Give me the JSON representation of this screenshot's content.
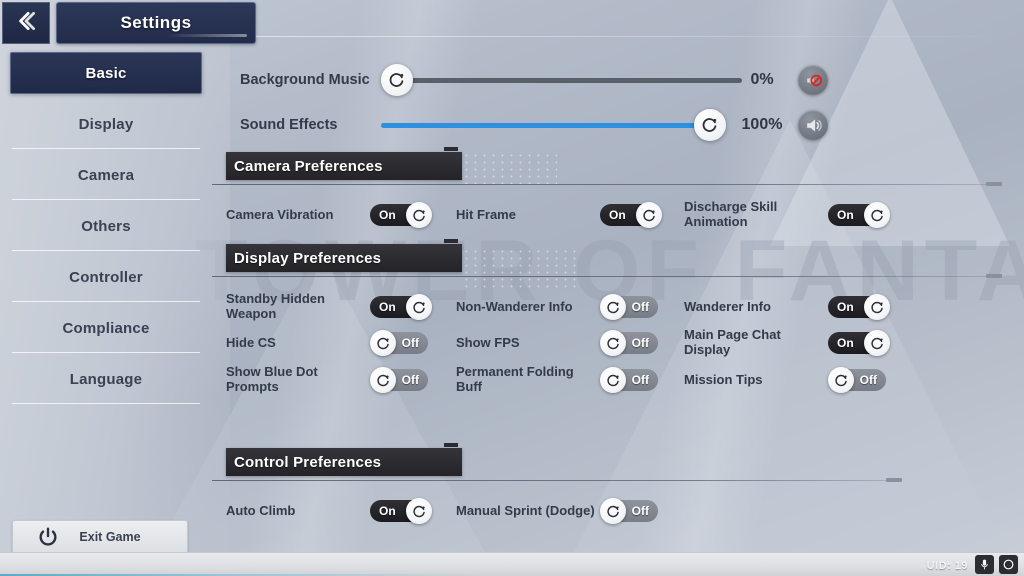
{
  "header": {
    "title": "Settings",
    "back_icon": "chevron-left-icon"
  },
  "sidebar": {
    "items": [
      {
        "label": "Basic",
        "selected": true
      },
      {
        "label": "Display",
        "selected": false
      },
      {
        "label": "Camera",
        "selected": false
      },
      {
        "label": "Others",
        "selected": false
      },
      {
        "label": "Controller",
        "selected": false
      },
      {
        "label": "Compliance",
        "selected": false
      },
      {
        "label": "Language",
        "selected": false
      }
    ],
    "exit": {
      "label": "Exit Game",
      "icon": "power-icon"
    }
  },
  "audio": {
    "sliders": [
      {
        "label": "Background Music",
        "value": "0%",
        "percent": 0,
        "fill_color": "#5a6069",
        "icon": "speaker-muted-icon",
        "muted": true
      },
      {
        "label": "Sound Effects",
        "value": "100%",
        "percent": 100,
        "fill_color": "#2f8fe0",
        "icon": "speaker-icon",
        "muted": false
      }
    ]
  },
  "sections": [
    {
      "title": "Camera Preferences",
      "rows": [
        [
          {
            "label": "Camera Vibration",
            "state": "On"
          },
          {
            "label": "Hit Frame",
            "state": "On"
          },
          {
            "label": "Discharge Skill Animation",
            "state": "On"
          }
        ]
      ]
    },
    {
      "title": "Display Preferences",
      "rows": [
        [
          {
            "label": "Standby Hidden Weapon",
            "state": "On"
          },
          {
            "label": "Non-Wanderer Info",
            "state": "Off"
          },
          {
            "label": "Wanderer Info",
            "state": "On"
          }
        ],
        [
          {
            "label": "Hide CS",
            "state": "Off"
          },
          {
            "label": "Show FPS",
            "state": "Off"
          },
          {
            "label": "Main Page Chat Display",
            "state": "On"
          }
        ],
        [
          {
            "label": "Show Blue Dot Prompts",
            "state": "Off"
          },
          {
            "label": "Permanent Folding Buff",
            "state": "Off"
          },
          {
            "label": "Mission Tips",
            "state": "Off"
          }
        ]
      ]
    },
    {
      "title": "Control Preferences",
      "rows": [
        [
          {
            "label": "Auto Climb",
            "state": "On"
          },
          {
            "label": "Manual Sprint (Dodge)",
            "state": "Off"
          }
        ]
      ]
    }
  ],
  "background": {
    "watermark": "TOWER OF FANTASY"
  },
  "status_bar": {
    "uid": "UID: 19",
    "mic_icon": "microphone-icon",
    "circle_icon": "circle-icon"
  }
}
